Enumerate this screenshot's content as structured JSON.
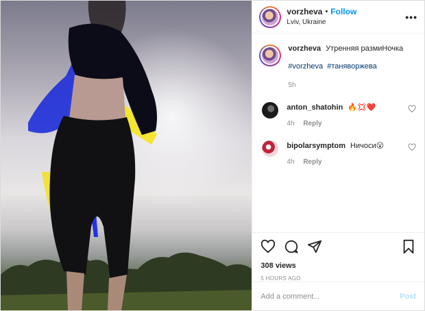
{
  "header": {
    "username": "vorzheva",
    "separator": "•",
    "follow_label": "Follow",
    "location": "Lviv, Ukraine",
    "more_label": "•••"
  },
  "caption": {
    "username": "vorzheva",
    "text": "Утренняя размиНочка",
    "hashtags": [
      "#vorzheva",
      "#таняворжева"
    ],
    "time": "5h"
  },
  "comments": [
    {
      "username": "anton_shatohin",
      "text": "🔥💢❤️",
      "time": "4h",
      "reply_label": "Reply"
    },
    {
      "username": "bipolarsymptom",
      "text": "Ничоси😮",
      "time": "4h",
      "reply_label": "Reply"
    }
  ],
  "actions": {
    "views": "308 views",
    "time_ago": "5 HOURS AGO",
    "icons": [
      "heart-icon",
      "comment-icon",
      "share-icon",
      "bookmark-icon"
    ]
  },
  "add_comment": {
    "placeholder": "Add a comment...",
    "post_label": "Post"
  },
  "colors": {
    "link": "#0095f6",
    "hashtag": "#00376b",
    "muted": "#8e8e8e",
    "post_disabled": "#b2dffc"
  }
}
